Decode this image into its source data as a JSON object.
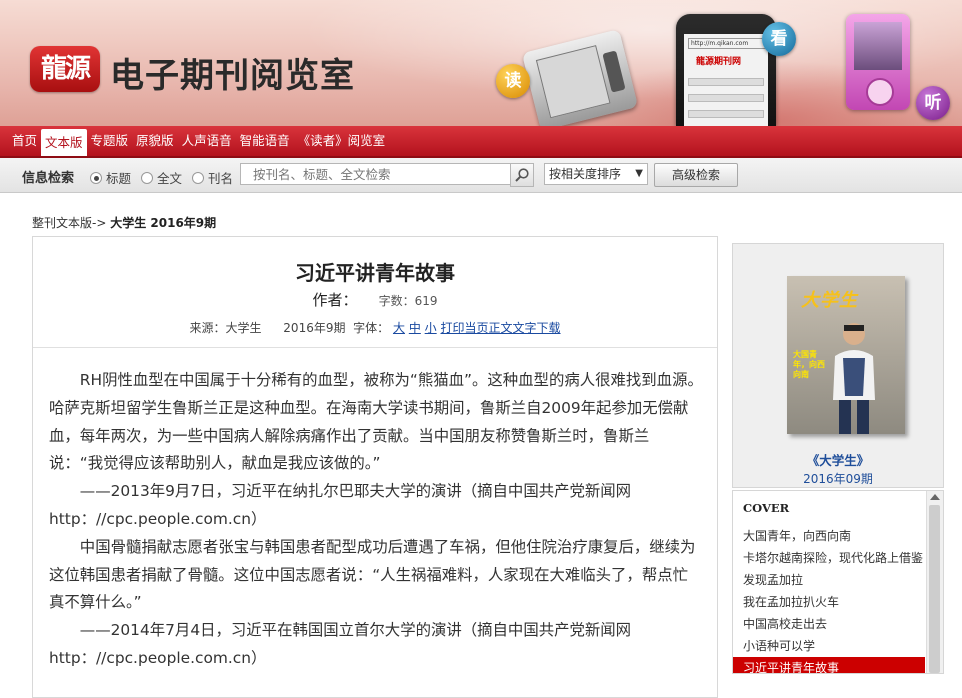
{
  "banner": {
    "logo_text": "龍源",
    "title": "电子期刊阅览室",
    "badge_read": "读",
    "badge_look": "看",
    "badge_listen": "听",
    "phone_url": "http://m.qikan.com",
    "phone_logo": "龍源期刊网"
  },
  "nav": {
    "items": [
      "首页",
      "文本版",
      "专题版",
      "原貌版",
      "人声语音",
      "智能语音",
      "《读者》阅览室"
    ],
    "active_index": 1
  },
  "search": {
    "label": "信息检索",
    "radio_options": [
      "标题",
      "全文",
      "刊名"
    ],
    "selected_radio": 0,
    "placeholder": "按刊名、标题、全文检索",
    "sort_value": "按相关度排序",
    "advanced_label": "高级检索"
  },
  "breadcrumb": {
    "prefix": "整刊文本版->",
    "current": "大学生  2016年9期"
  },
  "article": {
    "title": "习近平讲青年故事",
    "author_label": "作者：",
    "word_count": "字数：619",
    "source": "来源：大学生",
    "issue": "2016年9期",
    "font_label": "字体：",
    "font_sizes": [
      "大",
      "中",
      "小"
    ],
    "print_link": "打印当页正文文字",
    "download_link": "下载",
    "paragraphs": [
      "RH阴性血型在中国属于十分稀有的血型，被称为“熊猫血”。这种血型的病人很难找到血源。哈萨克斯坦留学生鲁斯兰正是这种血型。在海南大学读书期间，鲁斯兰自2009年起参加无偿献血，每年两次，为一些中国病人解除病痛作出了贡献。当中国朋友称赞鲁斯兰时，鲁斯兰说：“我觉得应该帮助别人，献血是我应该做的。”",
      "——2013年9月7日，习近平在纳扎尔巴耶夫大学的演讲（摘自中国共产党新闻网http：//cpc.people.com.cn）",
      "中国骨髓捐献志愿者张宝与韩国患者配型成功后遭遇了车祸，但他住院治疗康复后，继续为这位韩国患者捐献了骨髓。这位中国志愿者说：“人生祸福难料，人家现在大难临头了，帮点忙真不算什么。”",
      "——2014年7月4日，习近平在韩国国立首尔大学的演讲（摘自中国共产党新闻网http：//cpc.people.com.cn）"
    ]
  },
  "sidebar": {
    "cover_masthead": "大学生",
    "cover_headline": "大国青年，向西向南",
    "cover_caption": "《大学生》",
    "cover_date": "2016年09期",
    "toc_heading": "COVER",
    "toc_items": [
      "大国青年，向西向南",
      "卡塔尔越南探险，现代化路上借鉴",
      "发现孟加拉",
      "我在孟加拉扒火车",
      "中国高校走出去",
      "小语种可以学",
      "习近平讲青年故事"
    ],
    "toc_active_index": 6
  },
  "colors": {
    "nav_red": "#b3121d",
    "link_blue": "#1a4aa0",
    "toc_active": "#cc0000"
  }
}
